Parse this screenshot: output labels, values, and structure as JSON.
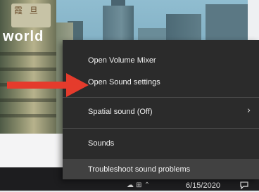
{
  "desktop": {
    "sign_text": "霞 旦",
    "headline": "world"
  },
  "context_menu": {
    "items": [
      {
        "label": "Open Volume Mixer"
      },
      {
        "label": "Open Sound settings"
      },
      {
        "label": "Spatial sound (Off)"
      },
      {
        "label": "Sounds"
      },
      {
        "label": "Troubleshoot sound problems"
      }
    ],
    "submenu_icon": "chevron-right-icon",
    "highlighted_item": "Troubleshoot sound problems"
  },
  "annotation": {
    "arrow_icon": "red-arrow-icon",
    "arrow_color": "#e53b2c",
    "points_to": "Open Sound settings"
  },
  "taskbar": {
    "tray_icons": "☁ ⊞ ⌃",
    "date": "6/15/2020",
    "notification_icon": "notification-icon"
  },
  "colors": {
    "menu_background": "#2b2b2b",
    "menu_highlight": "#414141",
    "menu_text": "#f2f2f2",
    "taskbar_background": "#1d1d1f"
  }
}
